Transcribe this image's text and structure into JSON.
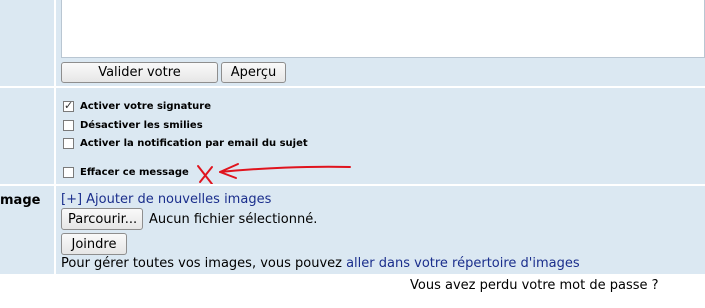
{
  "message_buttons": {
    "submit_label": "Valider votre message",
    "preview_label": "Aperçu"
  },
  "options": [
    {
      "label": "Activer votre signature",
      "checked": true
    },
    {
      "label": "Désactiver les smilies",
      "checked": false
    },
    {
      "label": "Activer la notification par email du sujet",
      "checked": false
    },
    {
      "label": "Effacer ce message",
      "checked": false
    }
  ],
  "image_section": {
    "label": "mage",
    "add_link": "[+] Ajouter de nouvelles images",
    "browse_label": "Parcourir...",
    "no_file_text": "Aucun fichier sélectionné.",
    "join_label": "Joindre",
    "manage_prefix": "Pour gérer toutes vos images, vous pouvez ",
    "manage_link": "aller dans votre répertoire d'images"
  },
  "lost_password_text": "Vous avez perdu votre mot de passe ?",
  "colors": {
    "panel_bg": "#dbe8f2",
    "link": "#1a2e8c",
    "annotation": "#e0141e"
  }
}
